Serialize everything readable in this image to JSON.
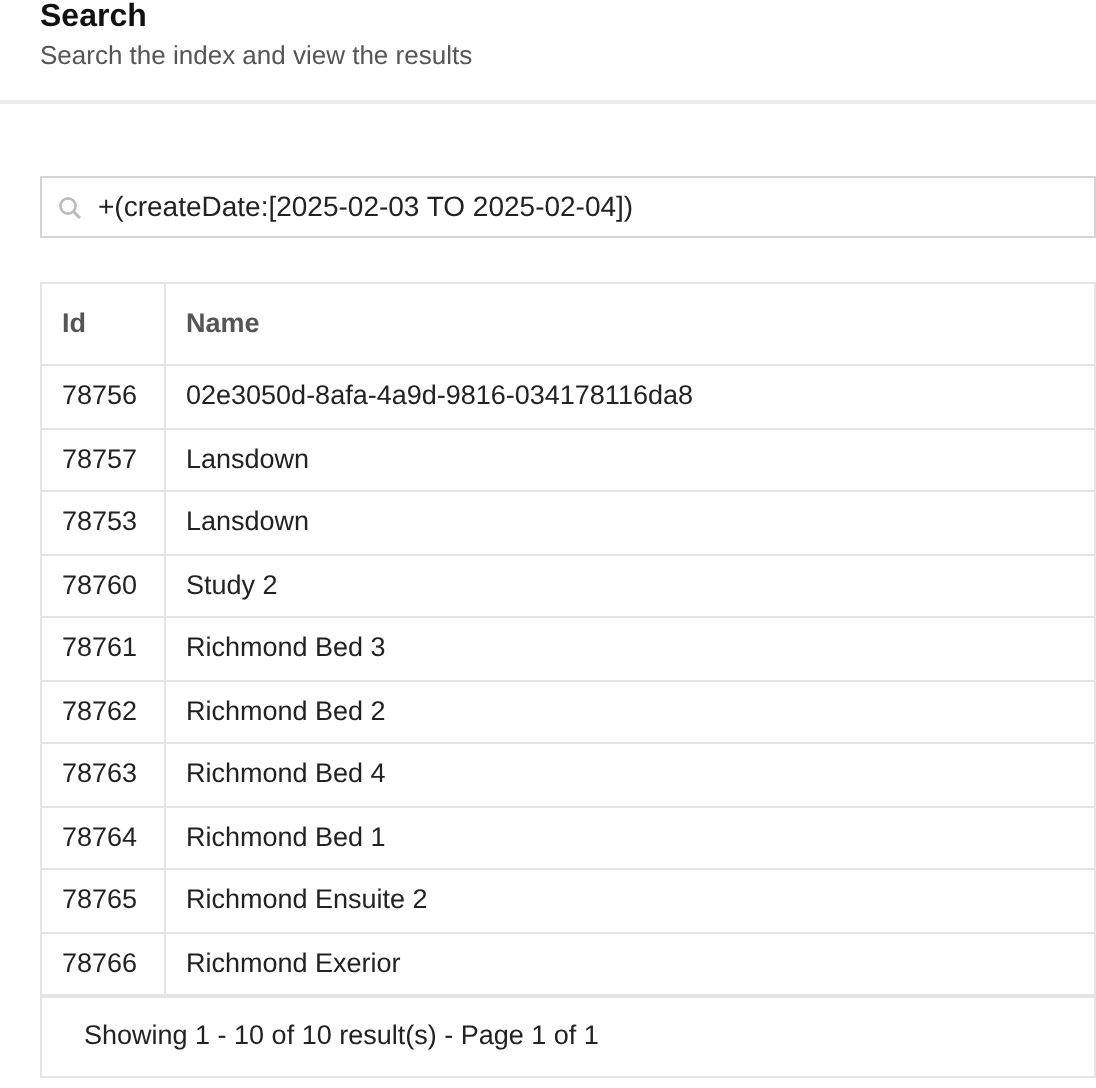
{
  "header": {
    "title": "Search",
    "subtitle": "Search the index and view the results"
  },
  "search": {
    "value": "+(createDate:[2025-02-03 TO 2025-02-04])"
  },
  "table": {
    "columns": [
      "Id",
      "Name"
    ],
    "rows": [
      {
        "id": "78756",
        "name": "02e3050d-8afa-4a9d-9816-034178116da8"
      },
      {
        "id": "78757",
        "name": "Lansdown"
      },
      {
        "id": "78753",
        "name": "Lansdown"
      },
      {
        "id": "78760",
        "name": "Study 2"
      },
      {
        "id": "78761",
        "name": "Richmond Bed 3"
      },
      {
        "id": "78762",
        "name": "Richmond Bed 2"
      },
      {
        "id": "78763",
        "name": "Richmond Bed 4"
      },
      {
        "id": "78764",
        "name": "Richmond Bed 1"
      },
      {
        "id": "78765",
        "name": "Richmond Ensuite 2"
      },
      {
        "id": "78766",
        "name": "Richmond Exerior"
      }
    ],
    "footer": "Showing 1 - 10 of 10 result(s) - Page 1 of 1"
  }
}
